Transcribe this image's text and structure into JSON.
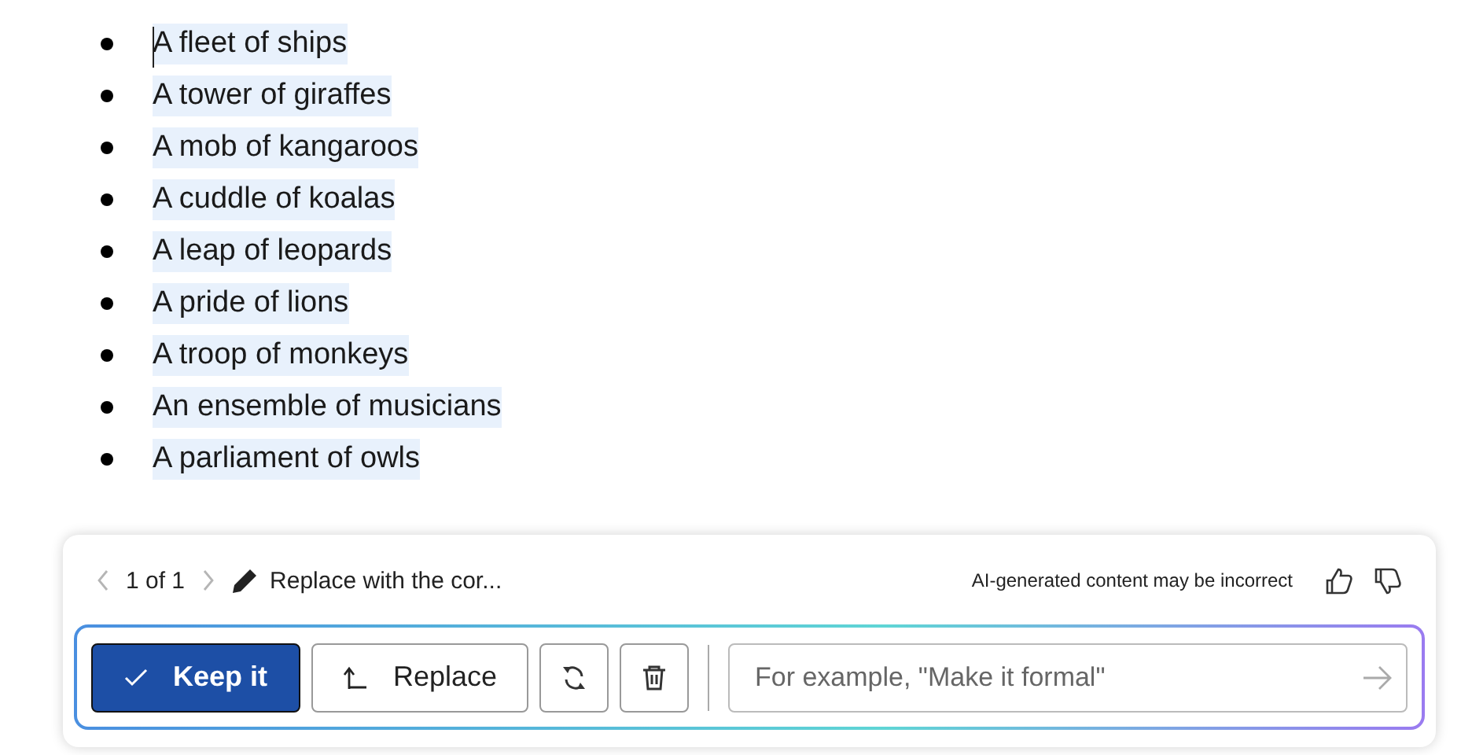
{
  "list": [
    {
      "text": "A fleet of ships",
      "highlighted": true
    },
    {
      "text": "A tower of giraffes",
      "highlighted": true
    },
    {
      "text": "A mob of kangaroos",
      "highlighted": true
    },
    {
      "text": "A cuddle of koalas",
      "highlighted": true
    },
    {
      "text": "A leap of leopards",
      "highlighted": true
    },
    {
      "text": "A pride of lions",
      "highlighted": true
    },
    {
      "text": "A troop of monkeys",
      "highlighted": true
    },
    {
      "text": "An ensemble of musicians",
      "highlighted": true
    },
    {
      "text": "A parliament of owls",
      "highlighted": true
    }
  ],
  "panel": {
    "pager": "1 of 1",
    "prompt": "Replace with the cor...",
    "disclaimer": "AI-generated content may be incorrect",
    "buttons": [
      {
        "kind": "keep",
        "label": "Keep it"
      },
      {
        "kind": "replace",
        "label": "Replace"
      },
      {
        "kind": "regenerate"
      },
      {
        "kind": "discard"
      }
    ],
    "input": {
      "placeholder": "For example, \"Make it formal\""
    }
  }
}
